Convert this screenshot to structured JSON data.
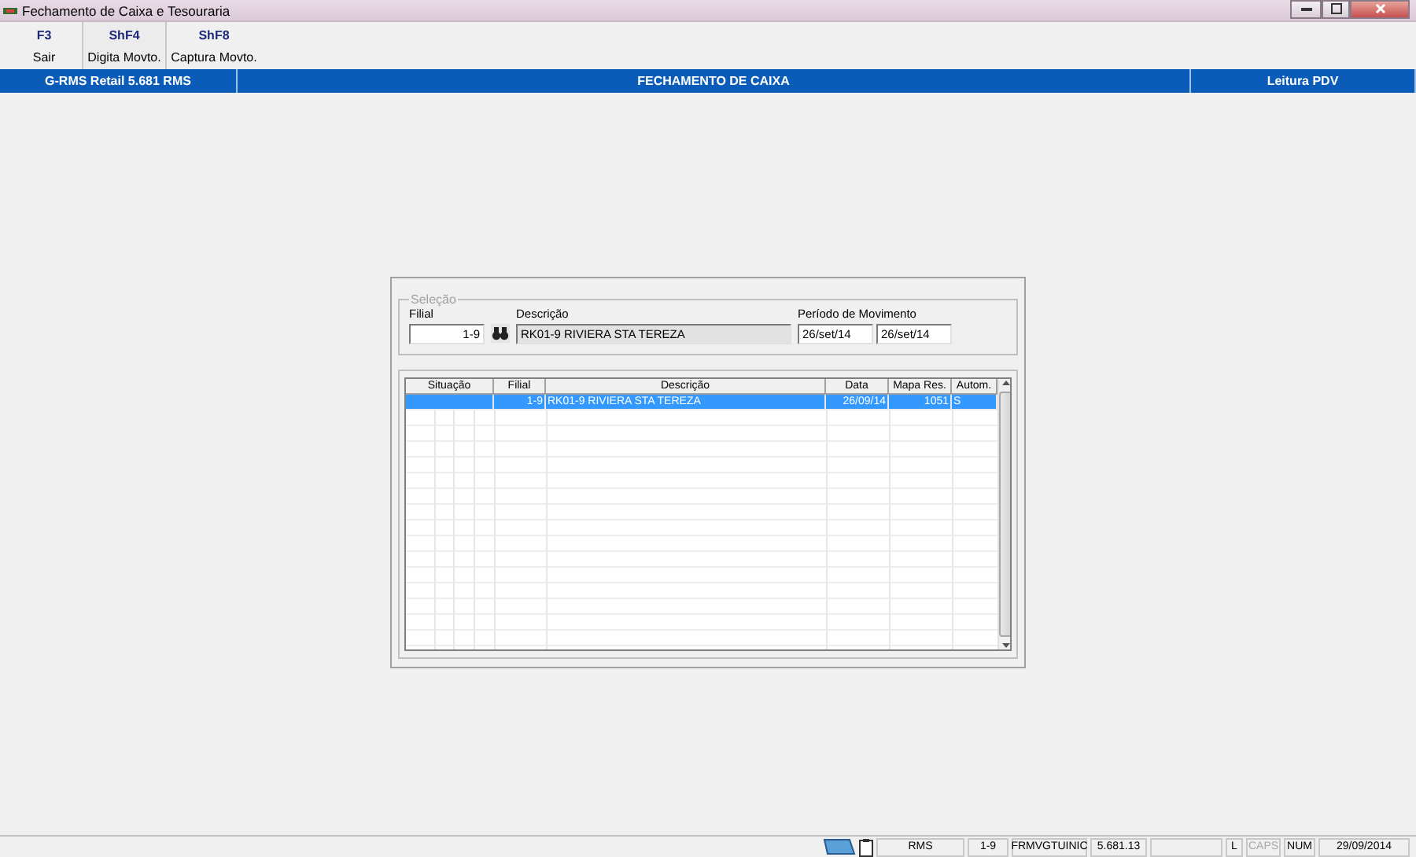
{
  "window": {
    "title": "Fechamento de Caixa e Tesouraria"
  },
  "toolbar": [
    {
      "key": "F3",
      "label": "Sair",
      "selected": false
    },
    {
      "key": "ShF4",
      "label": "Digita Movto.",
      "selected": true
    },
    {
      "key": "ShF8",
      "label": "Captura Movto.",
      "selected": false
    }
  ],
  "header": {
    "app": "G-RMS Retail 5.681 RMS",
    "title": "FECHAMENTO DE CAIXA",
    "mode": "Leitura PDV"
  },
  "selection": {
    "legend": "Seleção",
    "filial_label": "Filial",
    "filial": "1-9",
    "descricao_label": "Descrição",
    "descricao": "RK01-9 RIVIERA STA TEREZA",
    "periodo_label": "Período de Movimento",
    "periodo_inicio": "26/set/14",
    "periodo_fim": "26/set/14"
  },
  "table": {
    "columns": [
      "Situação",
      "Filial",
      "Descrição",
      "Data",
      "Mapa Res.",
      "Autom."
    ],
    "rows": [
      {
        "filial": "1-9",
        "descricao": "RK01-9 RIVIERA STA TEREZA",
        "data": "26/09/14",
        "mapa": "1051",
        "autom": "S",
        "selected": true
      }
    ]
  },
  "status_bar": {
    "user": "RMS",
    "filial": "1-9",
    "program": "FRMVGTUINIC",
    "version": "5.681.13",
    "lock": "L",
    "caps": {
      "text": "CAPS",
      "on": false
    },
    "num": {
      "text": "NUM",
      "on": true
    },
    "date": "29/09/2014"
  }
}
